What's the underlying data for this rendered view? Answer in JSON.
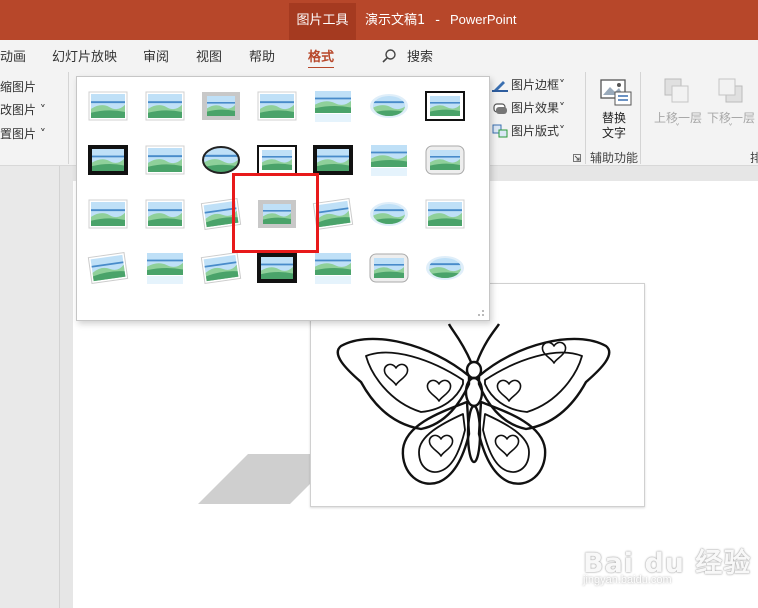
{
  "titlebar": {
    "context_tab": "图片工具",
    "doc_name": "演示文稿1",
    "separator": "-",
    "app_name": "PowerPoint"
  },
  "tabs": {
    "animation": "动画",
    "slideshow": "幻灯片放映",
    "review": "审阅",
    "view": "视图",
    "help": "帮助",
    "format": "格式",
    "search": "搜索"
  },
  "ribbon_left": {
    "compress": "缩图片",
    "change": "改图片",
    "reset": "置图片"
  },
  "ribbon_right": {
    "picture_border": "图片边框",
    "picture_effects": "图片效果",
    "picture_layout": "图片版式",
    "alt_text": [
      "替换",
      "文字"
    ],
    "accessibility_group": "辅助功能",
    "bring_forward": "上移一层",
    "send_backward": "下移一层",
    "arrange_partial": "排"
  },
  "gallery": {
    "rows": 4,
    "columns": 7,
    "selected_index": 17
  },
  "watermark": {
    "brand": "Bai du 经验",
    "url": "jingyan.baidu.com"
  },
  "colors": {
    "accent": "#b7472a",
    "highlight": "#e8191a"
  }
}
